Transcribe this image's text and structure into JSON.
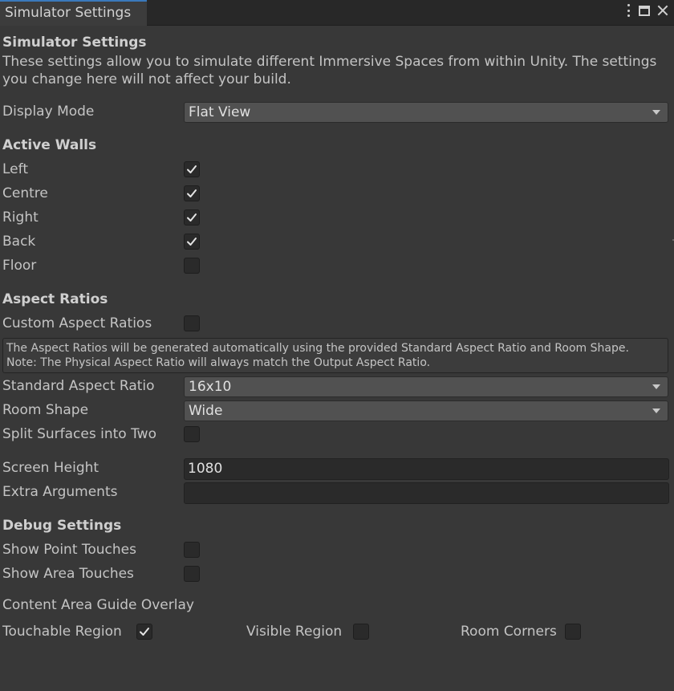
{
  "window": {
    "tab_title": "Simulator Settings"
  },
  "settings": {
    "title": "Simulator Settings",
    "description": "These settings allow you to simulate different Immersive Spaces from within Unity. The settings you change here will not affect your build.",
    "display_mode": {
      "label": "Display Mode",
      "value": "Flat View"
    }
  },
  "active_walls": {
    "title": "Active Walls",
    "items": [
      {
        "label": "Left",
        "checked": true
      },
      {
        "label": "Centre",
        "checked": true
      },
      {
        "label": "Right",
        "checked": true
      },
      {
        "label": "Back",
        "checked": true
      },
      {
        "label": "Floor",
        "checked": false
      }
    ]
  },
  "aspect": {
    "title": "Aspect Ratios",
    "custom": {
      "label": "Custom Aspect Ratios",
      "checked": false
    },
    "help_line1": "The Aspect Ratios will be generated automatically using the provided Standard Aspect Ratio and Room Shape.",
    "help_line2": "Note: The Physical Aspect Ratio will always match the Output Aspect Ratio.",
    "standard": {
      "label": "Standard Aspect Ratio",
      "value": "16x10"
    },
    "room_shape": {
      "label": "Room Shape",
      "value": "Wide"
    },
    "split": {
      "label": "Split Surfaces into Two",
      "checked": false
    }
  },
  "screen": {
    "height": {
      "label": "Screen Height",
      "value": "1080"
    },
    "extra": {
      "label": "Extra Arguments",
      "value": ""
    }
  },
  "debug": {
    "title": "Debug Settings",
    "point": {
      "label": "Show Point Touches",
      "checked": false
    },
    "area": {
      "label": "Show Area Touches",
      "checked": false
    },
    "overlay_title": "Content Area Guide Overlay",
    "touchable": {
      "label": "Touchable Region",
      "checked": true
    },
    "visible": {
      "label": "Visible Region",
      "checked": false
    },
    "corners": {
      "label": "Room Corners",
      "checked": false
    }
  }
}
